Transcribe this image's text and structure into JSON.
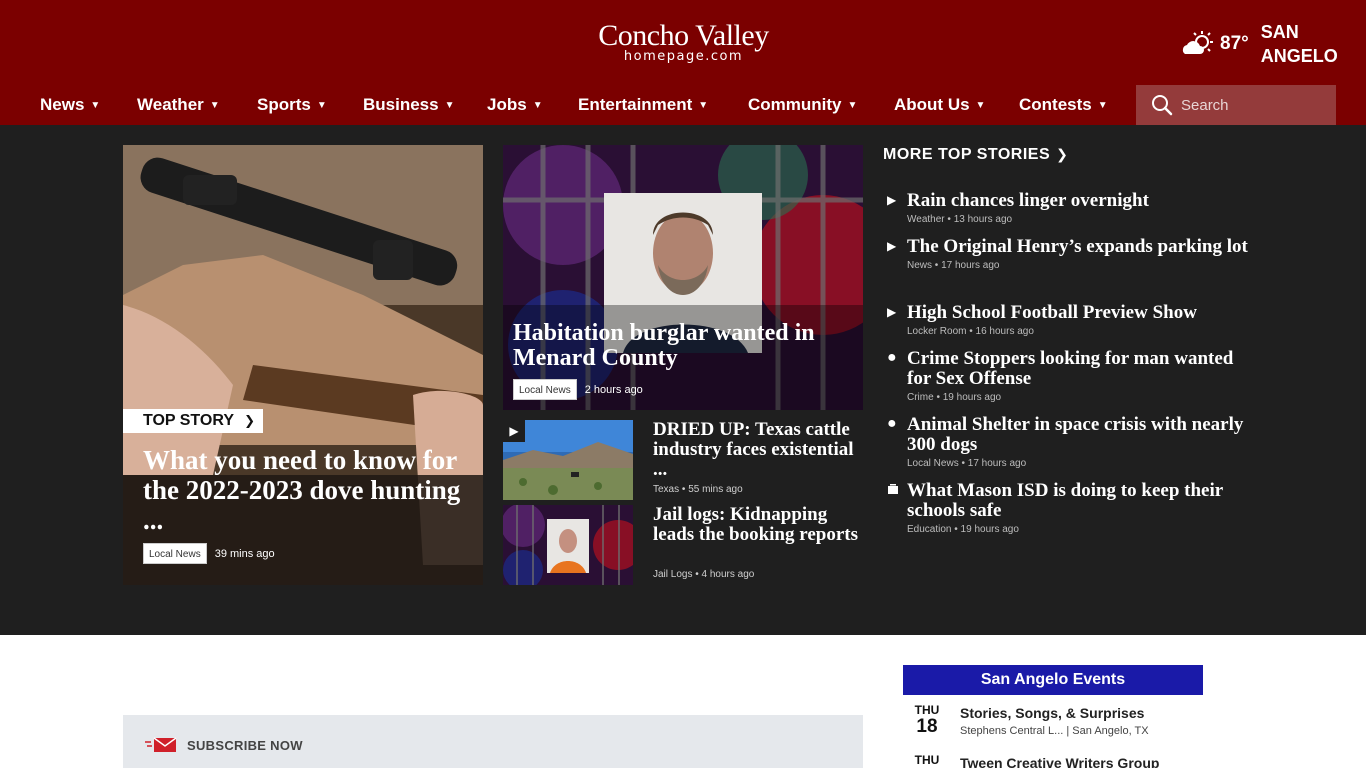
{
  "header": {
    "logo_main": "Concho Valley",
    "logo_sub": "homepage.com",
    "weather": {
      "temp": "87°",
      "city": "SAN ANGELO",
      "icon": "partly-sunny-icon"
    },
    "nav": [
      {
        "label": "News"
      },
      {
        "label": "Weather"
      },
      {
        "label": "Sports"
      },
      {
        "label": "Business"
      },
      {
        "label": "Jobs"
      },
      {
        "label": "Entertainment"
      },
      {
        "label": "Community"
      },
      {
        "label": "About Us"
      },
      {
        "label": "Contests"
      }
    ],
    "search_placeholder": "Search"
  },
  "top_story": {
    "tag": "TOP STORY",
    "title": "What you need to know for the 2022-2023 dove hunting ...",
    "category": "Local News",
    "time": "39 mins ago"
  },
  "featured": {
    "title": "Habitation burglar wanted in Menard County",
    "category": "Local News",
    "time": "2 hours ago"
  },
  "small_stories": [
    {
      "title": "DRIED UP: Texas cattle industry faces existential ...",
      "category": "Texas",
      "time": "55 mins ago",
      "has_video": true
    },
    {
      "title": "Jail logs: Kidnapping leads the booking reports",
      "category": "Jail Logs",
      "time": "4 hours ago",
      "has_video": false
    }
  ],
  "more_top_stories": {
    "heading": "MORE TOP STORIES",
    "items": [
      {
        "title": "Rain chances linger overnight",
        "category": "Weather",
        "time": "13 hours ago",
        "icon": "play-icon"
      },
      {
        "title": "The Original Henry’s expands parking lot",
        "category": "News",
        "time": "17 hours ago",
        "icon": "play-icon"
      },
      {
        "title": "High School Football Preview Show",
        "category": "Locker Room",
        "time": "16 hours ago",
        "icon": "play-icon"
      },
      {
        "title": "Crime Stoppers looking for man wanted for Sex Offense",
        "category": "Crime",
        "time": "19 hours ago",
        "icon": "dot-icon"
      },
      {
        "title": "Animal Shelter in space crisis with nearly 300 dogs",
        "category": "Local News",
        "time": "17 hours ago",
        "icon": "dot-icon"
      },
      {
        "title": "What Mason ISD is doing to keep their schools safe",
        "category": "Education",
        "time": "19 hours ago",
        "icon": "gallery-icon"
      }
    ]
  },
  "subscribe": {
    "label": "SUBSCRIBE NOW"
  },
  "events": {
    "heading": "San Angelo Events",
    "items": [
      {
        "dow": "THU",
        "day": "18",
        "title": "Stories, Songs, & Surprises",
        "location": "Stephens Central L... | San Angelo, TX"
      },
      {
        "dow": "THU",
        "day": "",
        "title": "Tween Creative Writers Group",
        "location": ""
      }
    ]
  },
  "colors": {
    "header_bg": "#7b0000",
    "band_bg": "#1f1f1f",
    "events_header": "#1a1aa8"
  }
}
